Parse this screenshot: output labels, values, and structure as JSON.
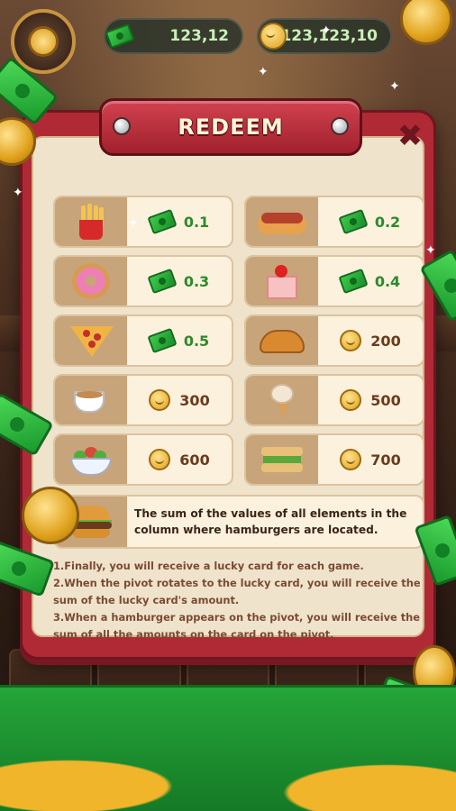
{
  "header": {
    "cash_balance": "123,12",
    "coin_balance": "123,123,10"
  },
  "modal": {
    "title": "REDEEM",
    "close_label": "✖",
    "items": [
      {
        "food": "fries",
        "currency": "cash",
        "value": "0.1"
      },
      {
        "food": "hotdog",
        "currency": "cash",
        "value": "0.2"
      },
      {
        "food": "donut",
        "currency": "cash",
        "value": "0.3"
      },
      {
        "food": "cake",
        "currency": "cash",
        "value": "0.4"
      },
      {
        "food": "pizza",
        "currency": "cash",
        "value": "0.5"
      },
      {
        "food": "croissant",
        "currency": "coin",
        "value": "200"
      },
      {
        "food": "coffee",
        "currency": "coin",
        "value": "300"
      },
      {
        "food": "icecream",
        "currency": "coin",
        "value": "500"
      },
      {
        "food": "salad",
        "currency": "coin",
        "value": "600"
      },
      {
        "food": "sandwich",
        "currency": "coin",
        "value": "700"
      }
    ],
    "burger_description": "The sum of the values of all elements in the column where hamburgers are located.",
    "rules": [
      "1.Finally, you will receive a lucky card for each game.",
      "2.When the pivot rotates to the lucky card, you will receive the sum of the lucky card's amount.",
      "3.When a hamburger appears on the pivot, you will receive the sum of all the amounts on the card on the pivot."
    ]
  },
  "colors": {
    "modal_frame": "#b02a36",
    "panel": "#efe3cc",
    "cash_text": "#2d8a2a",
    "coin_text": "#6b3a1c"
  }
}
